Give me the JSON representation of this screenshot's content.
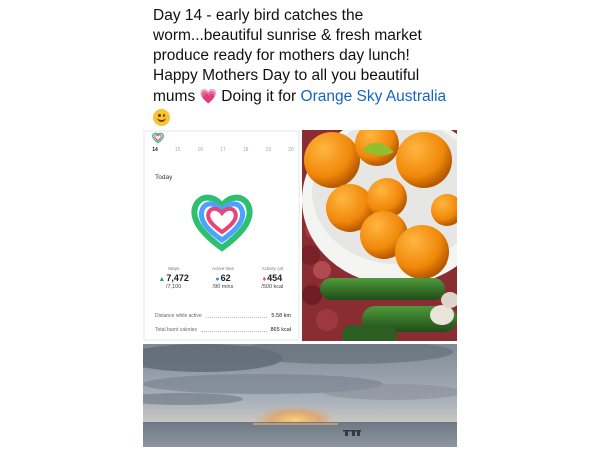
{
  "post": {
    "line1": "Day 14 - early bird catches the",
    "line2": "worm...beautiful sunrise & fresh market",
    "line3": "produce ready for mothers day lunch!",
    "line4": "Happy Mothers Day to all you beautiful",
    "line5_start": "mums",
    "line5_mid": "Doing it for",
    "link": "Orange Sky Australia",
    "heart_emoji": "💗",
    "smile_emoji": "smiling-face"
  },
  "health": {
    "days": [
      "14",
      "15",
      "16",
      "17",
      "18",
      "19",
      "20"
    ],
    "active_day": "14",
    "today_label": "Today",
    "stats": [
      {
        "label": "Steps",
        "value": "7,472",
        "goal": "/7,100",
        "color": "#2fa84f"
      },
      {
        "label": "Active time",
        "value": "62",
        "goal": "/90 mins",
        "color": "#3a86ff"
      },
      {
        "label": "Activity cal",
        "value": "454",
        "goal": "/500 kcal",
        "color": "#e8457a"
      }
    ],
    "distance_label": "Distance while active",
    "distance_value": "5.58 km",
    "burnt_label": "Total burnt calories",
    "burnt_value": "865 kcal"
  },
  "colors": {
    "link": "#1565c0",
    "ring_green": "#2fbf71",
    "ring_blue": "#4aa3ff",
    "ring_pink": "#e8457a"
  }
}
